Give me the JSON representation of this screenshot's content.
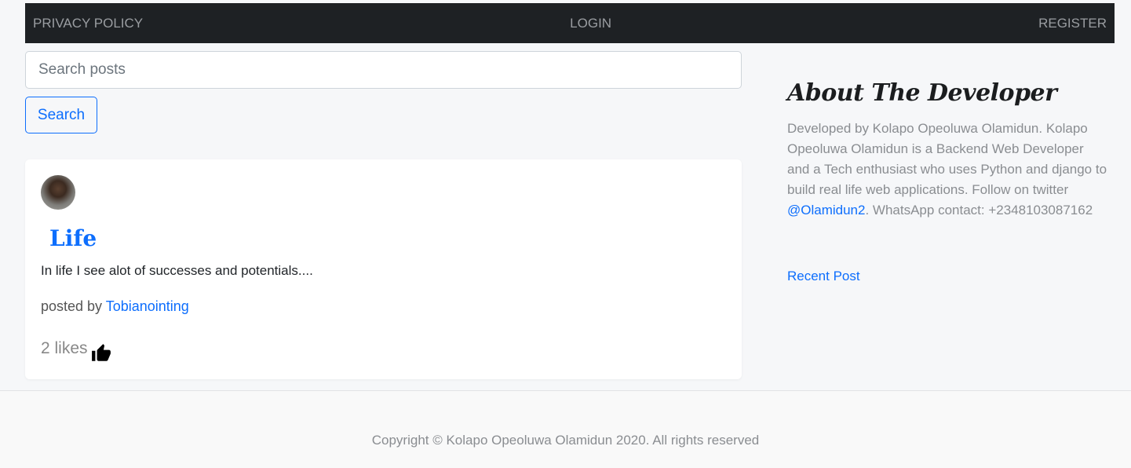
{
  "navbar": {
    "privacy_label": "PRIVACY POLICY",
    "login_label": "LOGIN",
    "register_label": "REGISTER"
  },
  "search": {
    "placeholder": "Search posts",
    "button_label": "Search"
  },
  "post": {
    "title": "Life",
    "excerpt": "In life I see alot of successes and potentials....",
    "posted_by_prefix": "posted by ",
    "author": "Tobianointing",
    "likes": "2 likes",
    "like_icon": "thumbs-up-icon"
  },
  "sidebar": {
    "about_title": "About The Developer",
    "about_text": "Developed by Kolapo Opeoluwa Olamidun. Kolapo Opeoluwa Olamidun is a Backend Web Developer and a Tech enthusiast who uses Python and django to build real life web applications. Follow on twitter ",
    "twitter_handle": "@Olamidun2",
    "about_text_after": ". WhatsApp contact: +2348103087162",
    "recent_post_label": "Recent Post"
  },
  "footer": {
    "copyright": "Copyright © Kolapo Opeoluwa Olamidun 2020. All rights reserved"
  },
  "colors": {
    "navbar_bg": "#1e2124",
    "link_blue": "#0d6efd",
    "page_bg": "#f6f7f9"
  }
}
